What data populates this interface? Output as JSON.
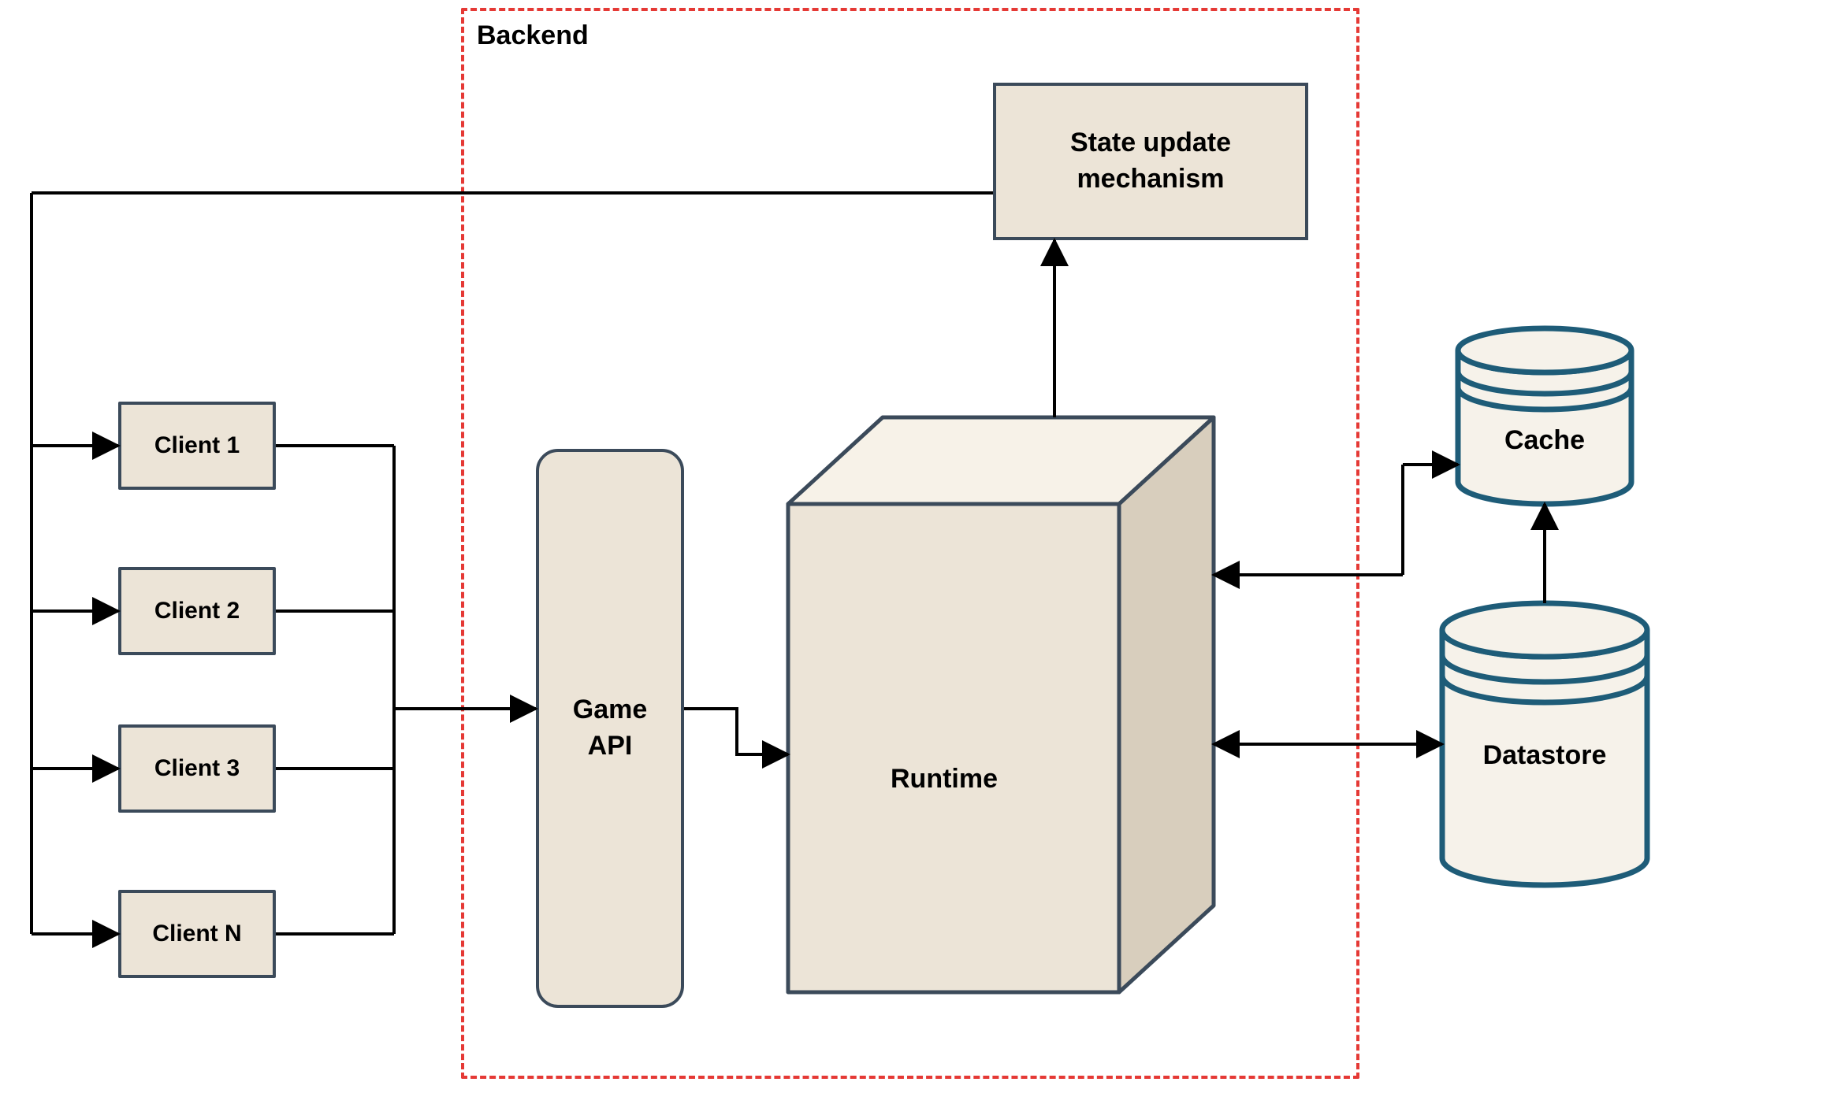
{
  "backend": {
    "label": "Backend"
  },
  "clients": {
    "c1": "Client 1",
    "c2": "Client 2",
    "c3": "Client 3",
    "cn": "Client N"
  },
  "game_api": {
    "label": "Game\nAPI"
  },
  "state_update": {
    "label": "State update\nmechanism"
  },
  "runtime": {
    "label": "Runtime"
  },
  "cache": {
    "label": "Cache"
  },
  "datastore": {
    "label": "Datastore"
  },
  "colors": {
    "box_fill": "#ece4d7",
    "box_border": "#3b4a5a",
    "backend_border": "#e53935",
    "cyl_border": "#1e5c78",
    "cyl_fill": "#f6f2ea",
    "arrow": "#000000"
  }
}
